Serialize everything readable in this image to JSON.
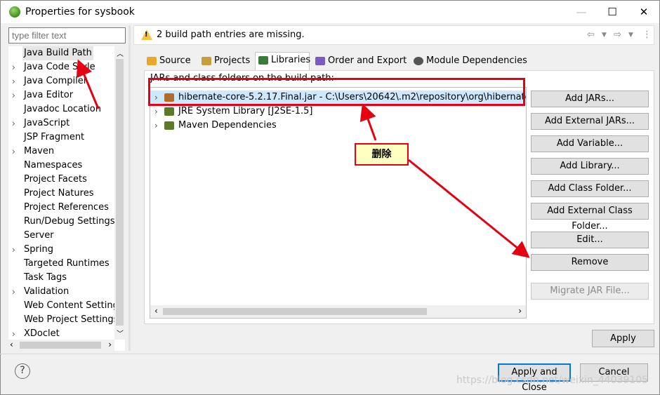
{
  "window": {
    "title": "Properties for sysbook",
    "controls": {
      "minimize": "—",
      "maximize": "☐",
      "close": "✕"
    }
  },
  "filter": {
    "placeholder": "type filter text"
  },
  "tree": {
    "items": [
      {
        "label": "Java Build Path",
        "expandable": false,
        "selected": true
      },
      {
        "label": "Java Code Style",
        "expandable": true
      },
      {
        "label": "Java Compiler",
        "expandable": true
      },
      {
        "label": "Java Editor",
        "expandable": true
      },
      {
        "label": "Javadoc Location",
        "expandable": false
      },
      {
        "label": "JavaScript",
        "expandable": true
      },
      {
        "label": "JSP Fragment",
        "expandable": false
      },
      {
        "label": "Maven",
        "expandable": true
      },
      {
        "label": "Namespaces",
        "expandable": false
      },
      {
        "label": "Project Facets",
        "expandable": false
      },
      {
        "label": "Project Natures",
        "expandable": false
      },
      {
        "label": "Project References",
        "expandable": false
      },
      {
        "label": "Run/Debug Settings",
        "expandable": false
      },
      {
        "label": "Server",
        "expandable": false
      },
      {
        "label": "Spring",
        "expandable": true
      },
      {
        "label": "Targeted Runtimes",
        "expandable": false
      },
      {
        "label": "Task Tags",
        "expandable": false
      },
      {
        "label": "Validation",
        "expandable": true
      },
      {
        "label": "Web Content Settings",
        "expandable": false
      },
      {
        "label": "Web Project Settings",
        "expandable": false
      },
      {
        "label": "XDoclet",
        "expandable": true
      }
    ]
  },
  "message": {
    "text": "2 build path entries are missing."
  },
  "tabs": [
    {
      "label": "Source",
      "icon": "source-folder-icon",
      "active": false
    },
    {
      "label": "Projects",
      "icon": "projects-folder-icon",
      "active": false
    },
    {
      "label": "Libraries",
      "icon": "libraries-icon",
      "active": true
    },
    {
      "label": "Order and Export",
      "icon": "order-export-icon",
      "active": false
    },
    {
      "label": "Module Dependencies",
      "icon": "module-dependencies-icon",
      "active": false
    }
  ],
  "libraries": {
    "section_label": "JARs and class folders on the build path:",
    "entries": [
      {
        "label": "hibernate-core-5.2.17.Final.jar - C:\\Users\\20642\\.m2\\repository\\org\\hibernate\\hibern",
        "icon": "jar-missing-icon",
        "selected": true
      },
      {
        "label": "JRE System Library [J2SE-1.5]",
        "icon": "library-icon",
        "selected": false
      },
      {
        "label": "Maven Dependencies",
        "icon": "library-icon",
        "selected": false
      }
    ]
  },
  "buttons": {
    "add_jars": "Add JARs...",
    "add_external_jars": "Add External JARs...",
    "add_variable": "Add Variable...",
    "add_library": "Add Library...",
    "add_class_folder": "Add Class Folder...",
    "add_external_class_folder": "Add External Class Folder...",
    "edit": "Edit...",
    "remove": "Remove",
    "migrate_jar": "Migrate JAR File...",
    "apply": "Apply",
    "apply_and_close": "Apply and Close",
    "cancel": "Cancel",
    "help": "?"
  },
  "annotation": {
    "callout_text": "删除",
    "color": "#e60012"
  },
  "watermark": "https://blog.csdn.net/weixin_44039105"
}
